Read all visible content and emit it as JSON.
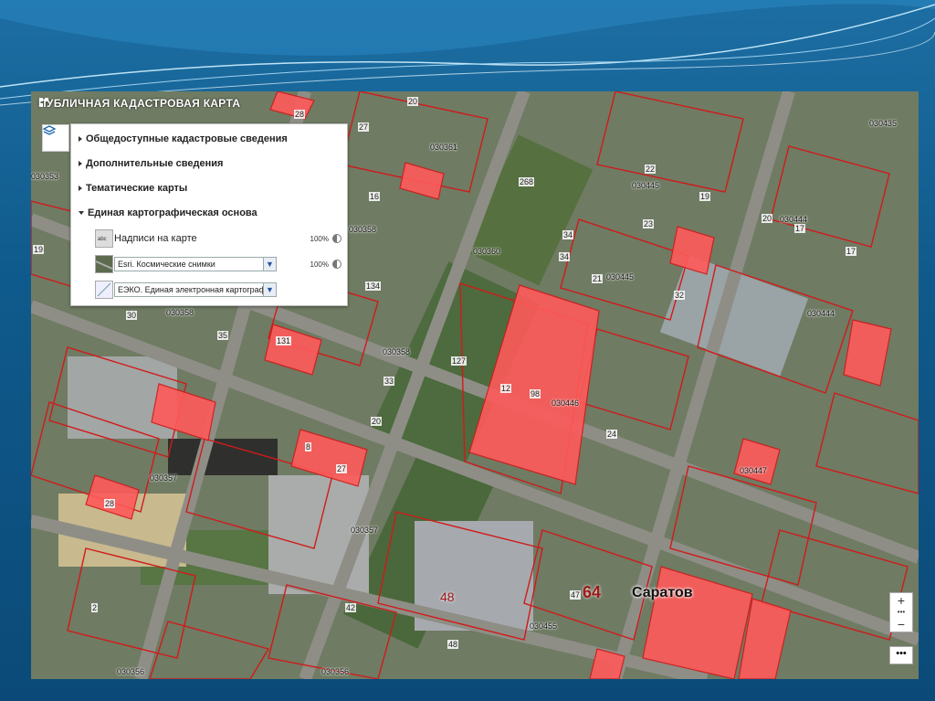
{
  "app_title": "ПУБЛИЧНАЯ КАДАСТРОВАЯ КАРТА",
  "layers_panel": {
    "sections": [
      {
        "label": "Общедоступные кадастровые сведения",
        "expanded": false
      },
      {
        "label": "Дополнительные сведения",
        "expanded": false
      },
      {
        "label": "Тематические карты",
        "expanded": false
      },
      {
        "label": "Единая картографическая основа",
        "expanded": true
      }
    ],
    "rows": [
      {
        "label": "Надписи на карте",
        "checked": true,
        "opacity": "100%"
      },
      {
        "select_value": "Esri. Космические снимки",
        "checked": true,
        "opacity": "100%"
      },
      {
        "select_value": "ЕЭКО. Единая электронная картографи",
        "checked": true
      }
    ]
  },
  "map": {
    "quarter_labels": [
      "030361",
      "030360",
      "030445",
      "030445",
      "030444",
      "030444",
      "030435",
      "030353",
      "030358",
      "030358",
      "030358",
      "030446",
      "030447",
      "030357",
      "030357",
      "030356",
      "030356",
      "030455"
    ],
    "parcel_numbers": [
      "28",
      "20",
      "27",
      "19",
      "22",
      "19",
      "23",
      "20",
      "17",
      "17",
      "16",
      "268",
      "34",
      "34",
      "21",
      "32",
      "134",
      "30",
      "35",
      "131",
      "33",
      "20",
      "127",
      "12",
      "98",
      "8",
      "27",
      "28",
      "24",
      "2",
      "48",
      "47",
      "42"
    ],
    "city_label": "Саратов",
    "region_number": "64",
    "district_number": "48"
  },
  "controls": {
    "zoom_in": "+",
    "zoom_out": "−",
    "more": "•••"
  },
  "colors": {
    "parcel_fill": "#ff5a5a",
    "parcel_stroke": "#d11a1a",
    "panel_bg": "#ffffff"
  }
}
